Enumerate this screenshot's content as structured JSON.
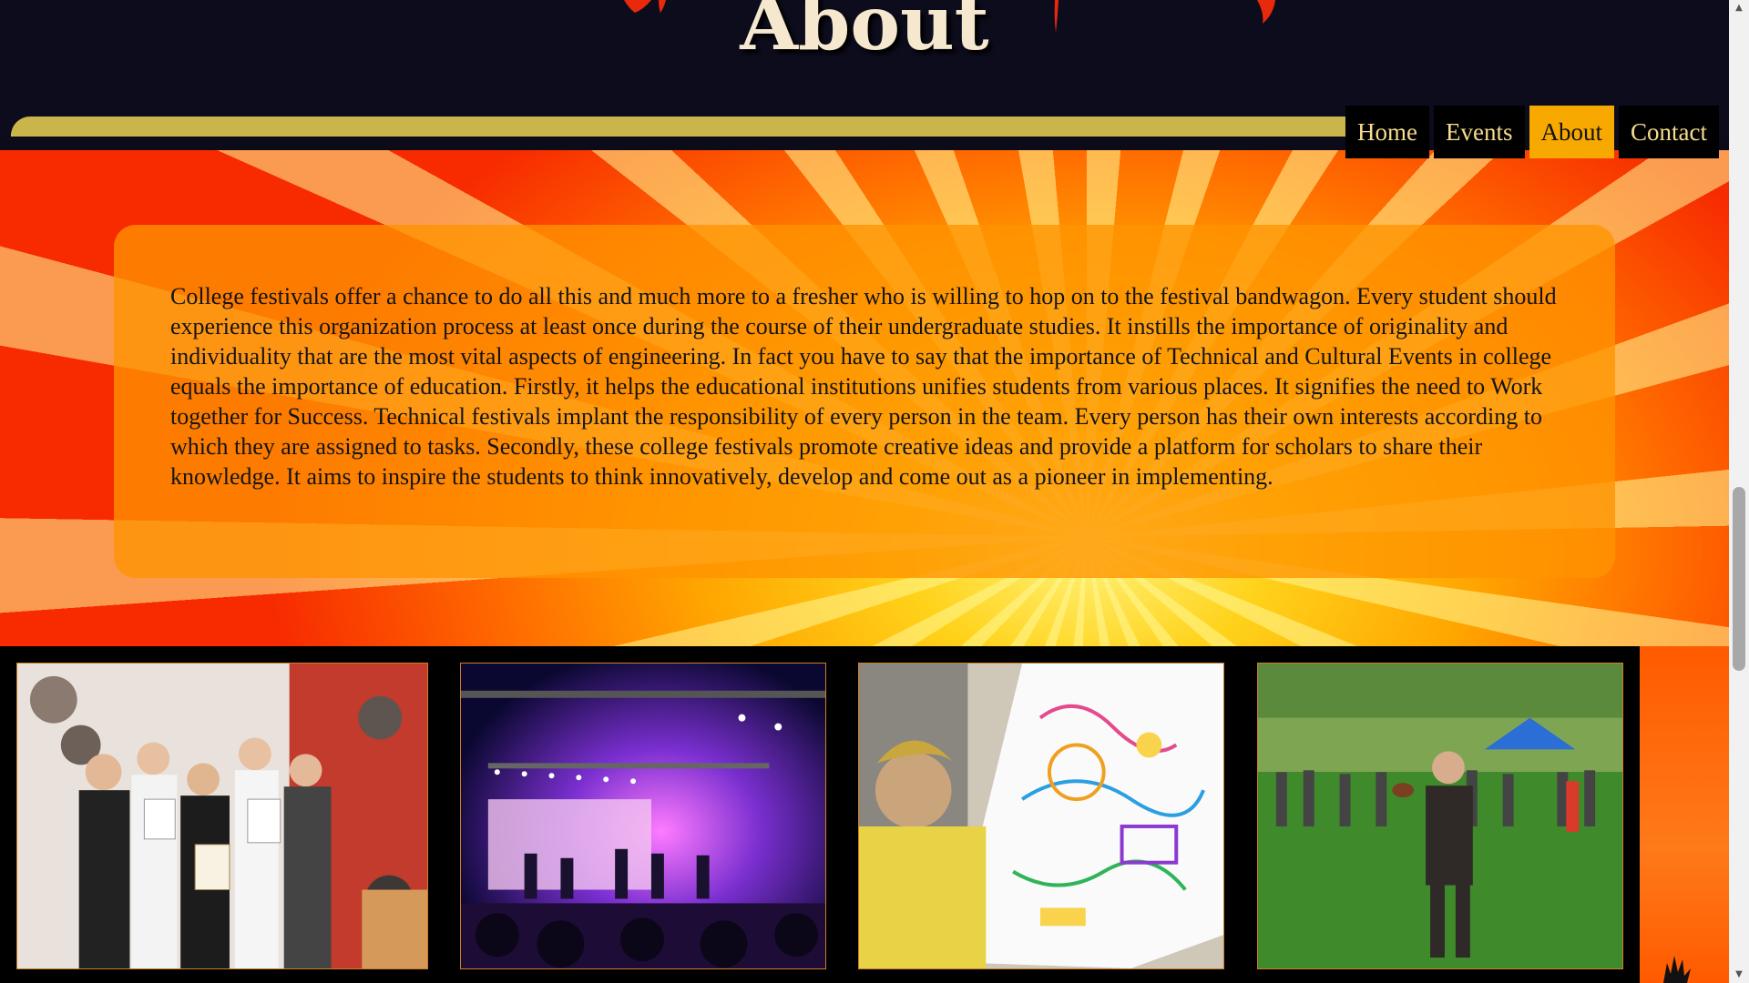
{
  "header": {
    "title": "About"
  },
  "nav": {
    "items": [
      {
        "label": "Home",
        "active": false
      },
      {
        "label": "Events",
        "active": false
      },
      {
        "label": "About",
        "active": true
      },
      {
        "label": "Contact",
        "active": false
      }
    ]
  },
  "main": {
    "paragraph": "College festivals offer a chance to do all this and much more to a fresher who is willing to hop on to the festival bandwagon. Every student should experience this organization process at least once during the course of their undergraduate studies. It instills the importance of originality and individuality that are the most vital aspects of engineering. In fact you have to say that the importance of Technical and Cultural Events in college equals the importance of education. Firstly, it helps the educational institutions unifies students from various places. It signifies the need to Work together for Success. Technical festivals implant the responsibility of every person in the team. Every person has their own interests according to which they are assigned to tasks. Secondly, these college festivals promote creative ideas and provide a platform for scholars to share their knowledge. It aims to inspire the students to think innovatively, develop and come out as a pioneer in implementing."
  },
  "gallery": {
    "photos": [
      {
        "subject": "award-group-photo"
      },
      {
        "subject": "concert-stage-photo"
      },
      {
        "subject": "painting-canvas-photo"
      },
      {
        "subject": "sports-field-photo"
      }
    ]
  },
  "colors": {
    "header_bg": "#0c0c1c",
    "ribbon": "#c9b54a",
    "nav_bg": "#000000",
    "nav_text": "#f6dc8c",
    "nav_active": "#f7a900",
    "panel": "#ff9400"
  }
}
